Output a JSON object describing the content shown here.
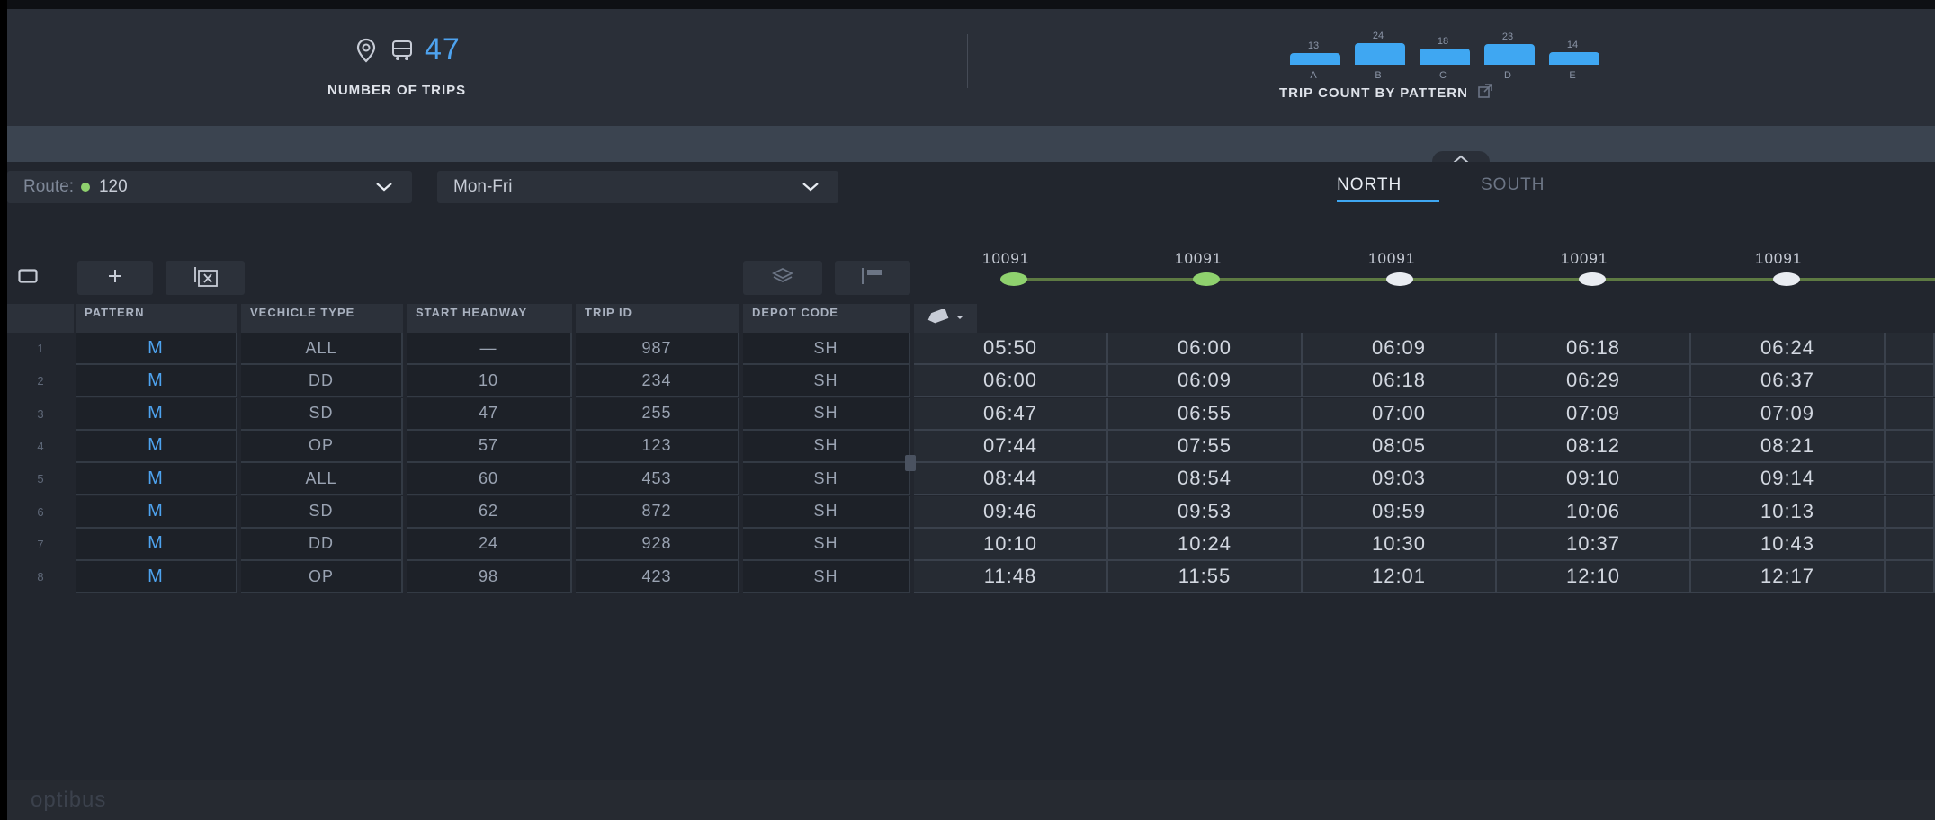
{
  "stats": {
    "trips": {
      "value": "47",
      "label": "NUMBER OF TRIPS"
    },
    "pattern_chart": {
      "label": "TRIP COUNT BY PATTERN"
    }
  },
  "chart_data": {
    "type": "bar",
    "categories": [
      "A",
      "B",
      "C",
      "D",
      "E"
    ],
    "values": [
      13,
      24,
      18,
      23,
      14
    ],
    "title": "TRIP COUNT BY PATTERN",
    "xlabel": "",
    "ylabel": "",
    "color": "#3fa7f2"
  },
  "filters": {
    "route": {
      "prefix": "Route:",
      "value": "120"
    },
    "days": {
      "value": "Mon-Fri"
    }
  },
  "direction_tabs": [
    {
      "label": "NORTH",
      "active": true
    },
    {
      "label": "SOUTH",
      "active": false
    }
  ],
  "stops": [
    {
      "id": "10091",
      "color": "#8fd16e"
    },
    {
      "id": "10091",
      "color": "#8fd16e"
    },
    {
      "id": "10091",
      "color": "#e9ecf1"
    },
    {
      "id": "10091",
      "color": "#e9ecf1"
    },
    {
      "id": "10091",
      "color": "#e9ecf1"
    }
  ],
  "table": {
    "columns": [
      "PATTERN",
      "VECHICLE TYPE",
      "START HEADWAY",
      "TRIP ID",
      "DEPOT CODE"
    ],
    "rows": [
      {
        "n": "1",
        "pattern": "M",
        "vehicle": "ALL",
        "headway": "—",
        "trip": "987",
        "depot": "SH",
        "times": [
          "05:50",
          "06:00",
          "06:09",
          "06:18",
          "06:24"
        ]
      },
      {
        "n": "2",
        "pattern": "M",
        "vehicle": "DD",
        "headway": "10",
        "trip": "234",
        "depot": "SH",
        "times": [
          "06:00",
          "06:09",
          "06:18",
          "06:29",
          "06:37"
        ]
      },
      {
        "n": "3",
        "pattern": "M",
        "vehicle": "SD",
        "headway": "47",
        "trip": "255",
        "depot": "SH",
        "times": [
          "06:47",
          "06:55",
          "07:00",
          "07:09",
          "07:09"
        ]
      },
      {
        "n": "4",
        "pattern": "M",
        "vehicle": "OP",
        "headway": "57",
        "trip": "123",
        "depot": "SH",
        "times": [
          "07:44",
          "07:55",
          "08:05",
          "08:12",
          "08:21"
        ]
      },
      {
        "n": "5",
        "pattern": "M",
        "vehicle": "ALL",
        "headway": "60",
        "trip": "453",
        "depot": "SH",
        "times": [
          "08:44",
          "08:54",
          "09:03",
          "09:10",
          "09:14"
        ]
      },
      {
        "n": "6",
        "pattern": "M",
        "vehicle": "SD",
        "headway": "62",
        "trip": "872",
        "depot": "SH",
        "times": [
          "09:46",
          "09:53",
          "09:59",
          "10:06",
          "10:13"
        ]
      },
      {
        "n": "7",
        "pattern": "M",
        "vehicle": "DD",
        "headway": "24",
        "trip": "928",
        "depot": "SH",
        "times": [
          "10:10",
          "10:24",
          "10:30",
          "10:37",
          "10:43"
        ]
      },
      {
        "n": "8",
        "pattern": "M",
        "vehicle": "OP",
        "headway": "98",
        "trip": "423",
        "depot": "SH",
        "times": [
          "11:48",
          "11:55",
          "12:01",
          "12:10",
          "12:17"
        ]
      }
    ]
  },
  "icons": {
    "trips": [
      "map-pin-icon",
      "bus-icon"
    ],
    "pattern_export": "external-link-icon",
    "collapse": "chevron-up-icon",
    "select_chevron": "chevron-down-icon",
    "actions": [
      "rectangle-icon",
      "plus-icon",
      "delete-column-icon",
      "layers-icon",
      "flag-icon"
    ],
    "grid": "grid-icon",
    "tag": "tag-icon"
  },
  "footer": {
    "brand": "optibus"
  }
}
